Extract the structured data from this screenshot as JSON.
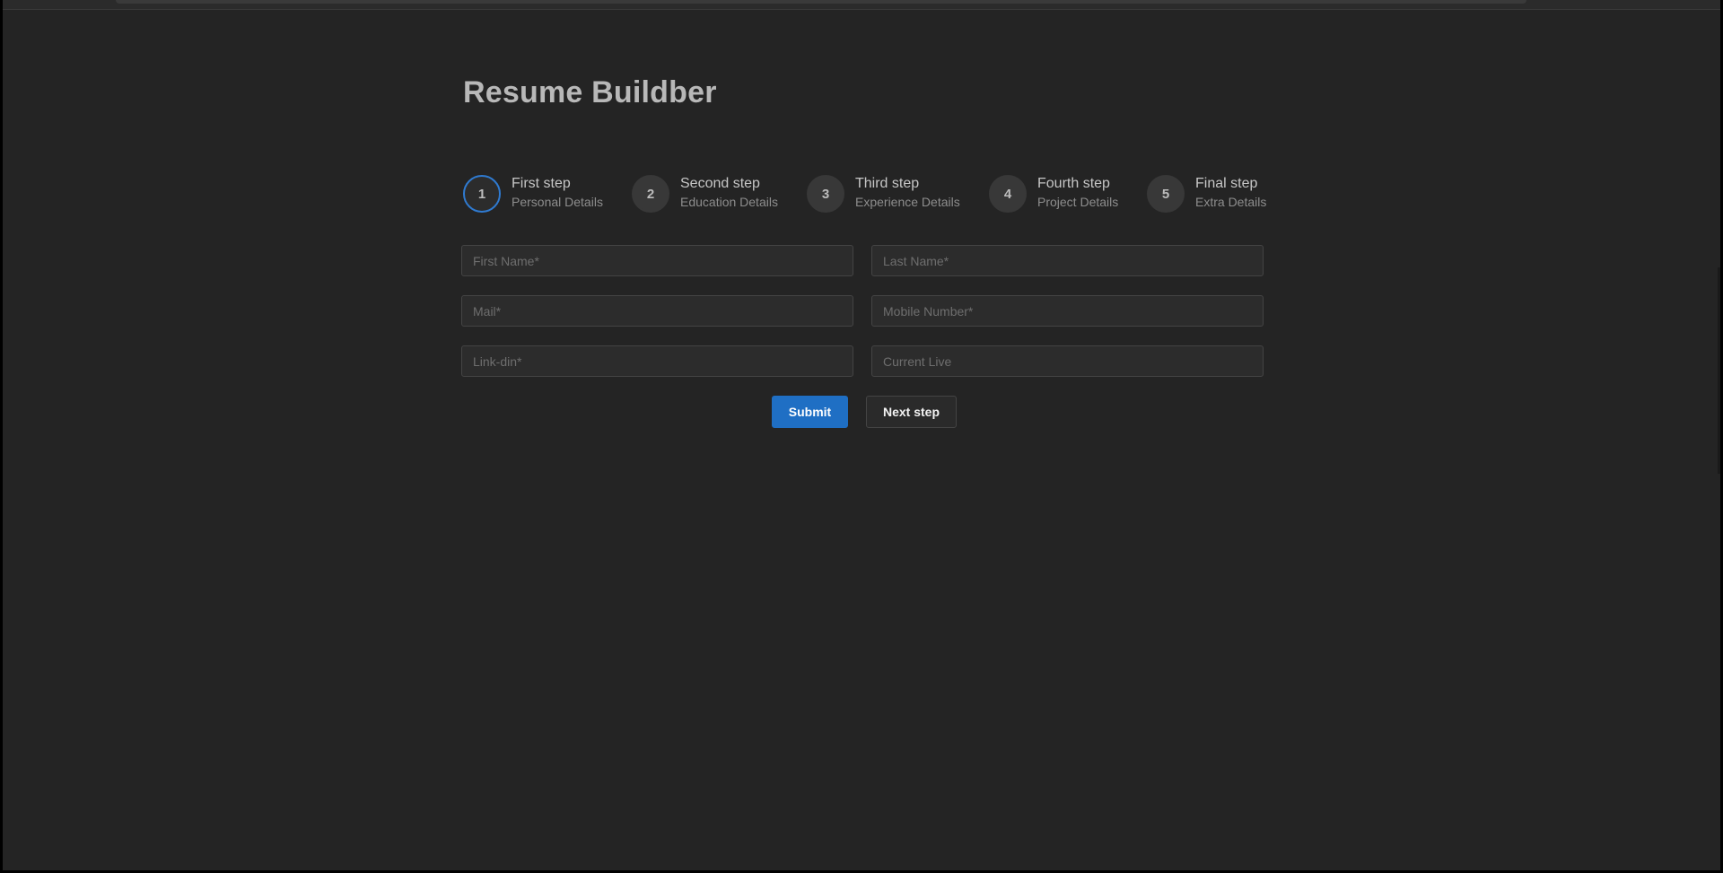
{
  "app": {
    "title": "Resume Buildber"
  },
  "steps": [
    {
      "number": "1",
      "title": "First step",
      "subtitle": "Personal Details",
      "active": true
    },
    {
      "number": "2",
      "title": "Second step",
      "subtitle": "Education Details",
      "active": false
    },
    {
      "number": "3",
      "title": "Third step",
      "subtitle": "Experience Details",
      "active": false
    },
    {
      "number": "4",
      "title": "Fourth step",
      "subtitle": "Project Details",
      "active": false
    },
    {
      "number": "5",
      "title": "Final step",
      "subtitle": "Extra Details",
      "active": false
    }
  ],
  "form": {
    "first_name": {
      "placeholder": "First Name*",
      "value": ""
    },
    "last_name": {
      "placeholder": "Last Name*",
      "value": ""
    },
    "mail": {
      "placeholder": "Mail*",
      "value": ""
    },
    "mobile": {
      "placeholder": "Mobile Number*",
      "value": ""
    },
    "linkedin": {
      "placeholder": "Link-din*",
      "value": ""
    },
    "current_live": {
      "placeholder": "Current Live",
      "value": ""
    }
  },
  "actions": {
    "submit_label": "Submit",
    "next_label": "Next step"
  },
  "colors": {
    "background": "#242424",
    "accent": "#1f6fc4",
    "active_step_ring": "#2f7ad0"
  }
}
